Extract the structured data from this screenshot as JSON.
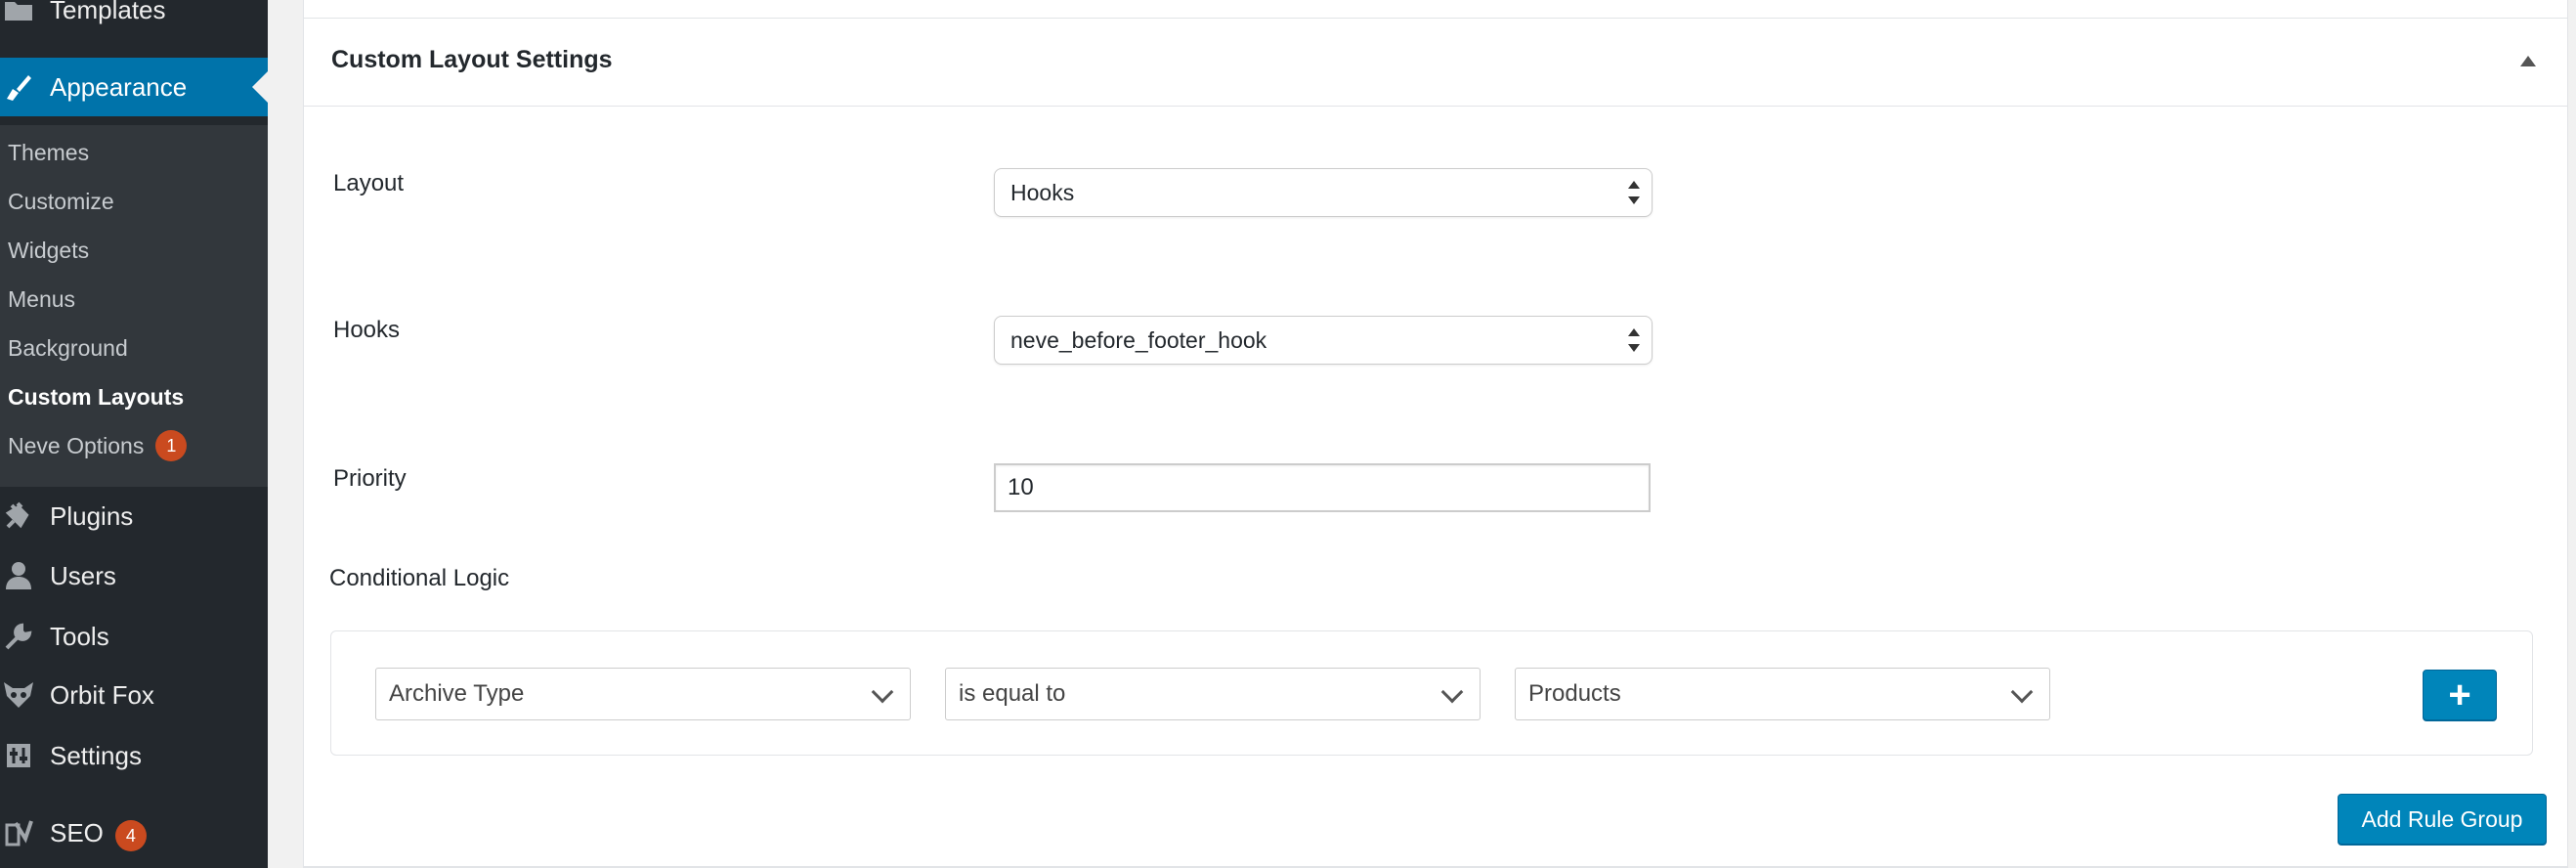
{
  "sidebar": {
    "top_items": [
      {
        "label": "Templates",
        "icon": "folder-icon"
      },
      {
        "label": "Appearance",
        "icon": "paintbrush-icon"
      },
      {
        "label": "Plugins",
        "icon": "plug-icon"
      },
      {
        "label": "Users",
        "icon": "user-icon"
      },
      {
        "label": "Tools",
        "icon": "wrench-icon"
      },
      {
        "label": "Orbit Fox",
        "icon": "fox-icon"
      },
      {
        "label": "Settings",
        "icon": "settings-icon"
      },
      {
        "label": "SEO",
        "icon": "yoast-icon",
        "badge": "4"
      }
    ],
    "submenu": [
      {
        "label": "Themes"
      },
      {
        "label": "Customize"
      },
      {
        "label": "Widgets"
      },
      {
        "label": "Menus"
      },
      {
        "label": "Background"
      },
      {
        "label": "Custom Layouts",
        "current": true
      },
      {
        "label": "Neve Options",
        "badge": "1"
      }
    ]
  },
  "panel": {
    "title": "Custom Layout Settings",
    "layout": {
      "label": "Layout",
      "value": "Hooks"
    },
    "hooks": {
      "label": "Hooks",
      "value": "neve_before_footer_hook"
    },
    "priority": {
      "label": "Priority",
      "value": "10"
    },
    "conditional_logic": {
      "label": "Conditional Logic",
      "rule": {
        "field": "Archive Type",
        "operator": "is equal to",
        "value": "Products"
      },
      "add_rule_label": "+",
      "add_group_label": "Add Rule Group"
    }
  },
  "colors": {
    "sidebar_bg": "#23282d",
    "submenu_bg": "#32373c",
    "accent": "#0073aa",
    "button": "#0085ba",
    "badge": "#ca4a1f"
  }
}
